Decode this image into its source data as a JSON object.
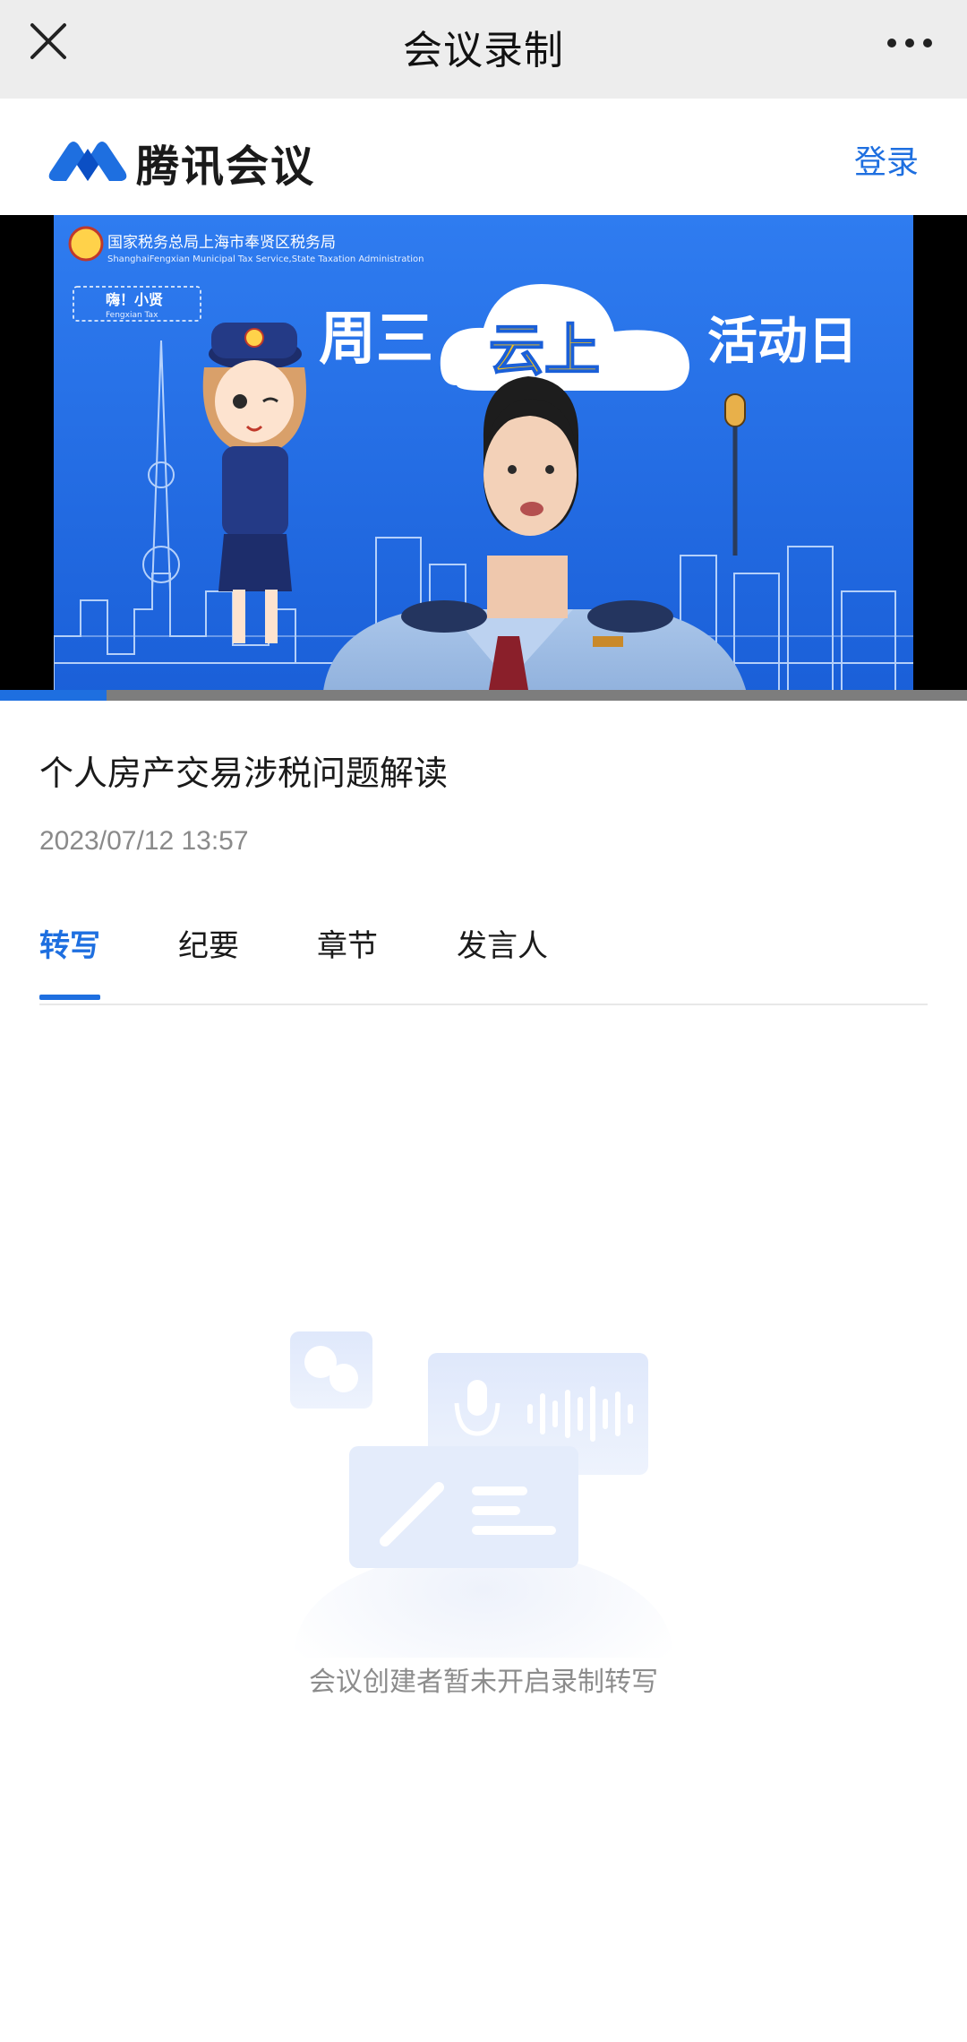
{
  "nav": {
    "title": "会议录制",
    "close_icon": "close-icon",
    "more_icon": "more-dots-icon"
  },
  "brand": {
    "name": "腾讯会议",
    "login_label": "登录",
    "accent": "#1e6fe0"
  },
  "video": {
    "org_name": "国家税务总局上海市奉贤区税务局",
    "org_name_en": "ShanghaiFengxian Municipal Tax Service,State Taxation Administration",
    "badge": "嗨！小贤",
    "badge_en": "Fengxian Tax",
    "banner_left": "周三",
    "banner_cloud": "云上",
    "banner_right": "活动日",
    "progress": 0.11
  },
  "meeting": {
    "title": "个人房产交易涉税问题解读",
    "time": "2023/07/12 13:57"
  },
  "tabs": [
    {
      "label": "转写",
      "active": true
    },
    {
      "label": "纪要",
      "active": false
    },
    {
      "label": "章节",
      "active": false
    },
    {
      "label": "发言人",
      "active": false
    }
  ],
  "empty_state": {
    "message": "会议创建者暂未开启录制转写"
  }
}
